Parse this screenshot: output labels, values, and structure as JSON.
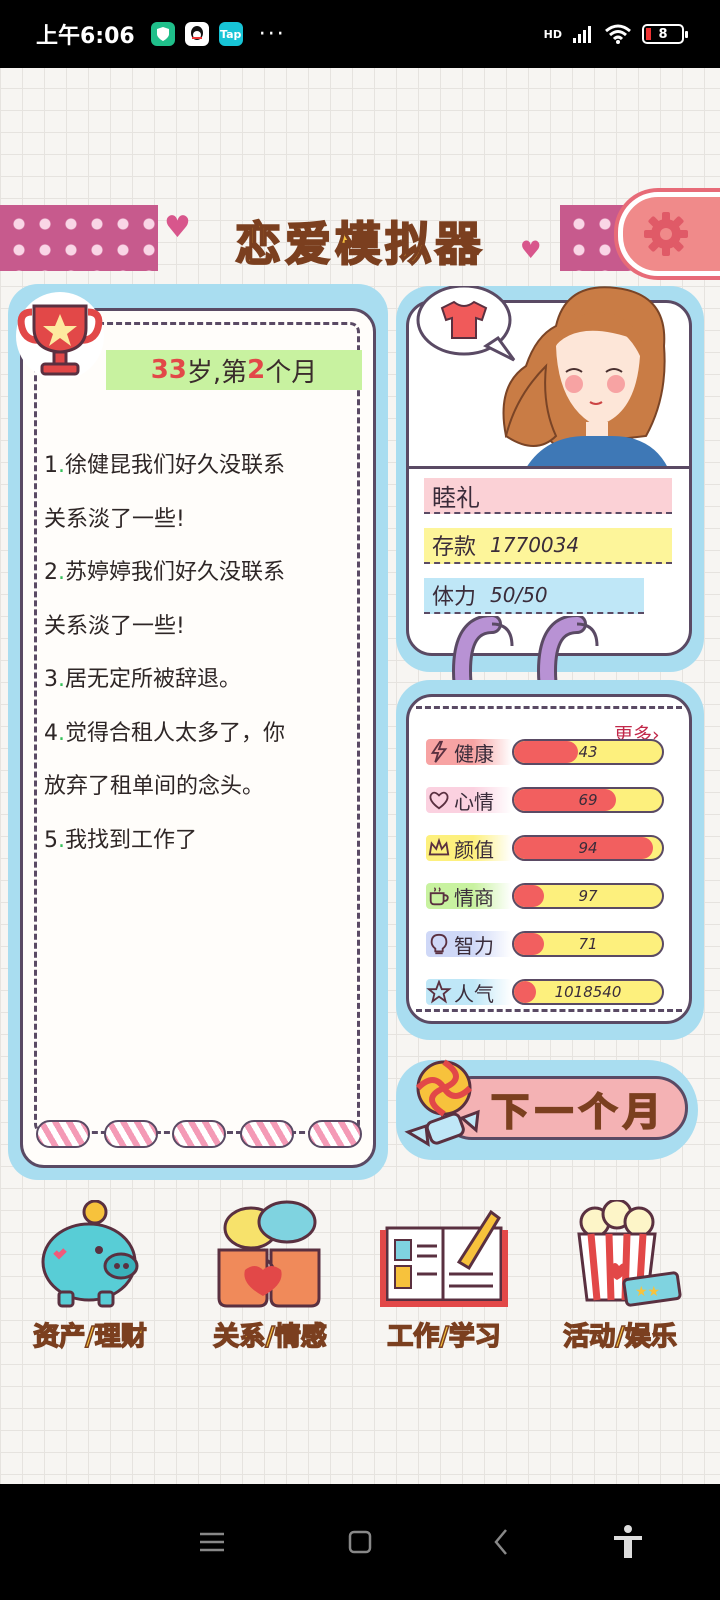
{
  "status_bar": {
    "time": "上午6:06",
    "notifications": [
      "shield-app-icon",
      "qq-icon",
      "taptap-icon"
    ],
    "taptap_label": "Tap",
    "more": "···",
    "network": "HD",
    "battery": "8"
  },
  "header": {
    "title": "恋爱模拟器"
  },
  "journal": {
    "age_prefix_num": "33",
    "age_mid": "岁,第",
    "month_num": "2",
    "age_suffix": "个月",
    "events": [
      {
        "n": "1",
        "text": "徐健昆我们好久没联系"
      },
      {
        "n": "",
        "text": "关系淡了一些!"
      },
      {
        "n": "2",
        "text": "苏婷婷我们好久没联系"
      },
      {
        "n": "",
        "text": "关系淡了一些!"
      },
      {
        "n": "3",
        "text": "居无定所被辞退。"
      },
      {
        "n": "4",
        "text": "觉得合租人太多了，你"
      },
      {
        "n": "",
        "text": "放弃了租单间的念头。"
      },
      {
        "n": "5",
        "text": "我找到工作了"
      }
    ]
  },
  "character": {
    "name": "睦礼",
    "savings_label": "存款",
    "savings_value": "1770034",
    "stamina_label": "体力",
    "stamina_value": "50/50"
  },
  "stats": {
    "more_label": "更多›",
    "items": [
      {
        "label": "健康",
        "value": "43",
        "level": 0.43,
        "icon": "lightning-icon",
        "tint": "#f7a3a3"
      },
      {
        "label": "心情",
        "value": "69",
        "level": 0.69,
        "icon": "heart-outline-icon",
        "tint": "#fbd1e0"
      },
      {
        "label": "颜值",
        "value": "94",
        "level": 0.94,
        "icon": "crown-icon",
        "tint": "#fdf07d"
      },
      {
        "label": "情商",
        "value": "97",
        "level": 0.2,
        "icon": "teacup-icon",
        "tint": "#c8f2a0"
      },
      {
        "label": "智力",
        "value": "71",
        "level": 0.2,
        "icon": "lightbulb-icon",
        "tint": "#cfd8f7"
      },
      {
        "label": "人气",
        "value": "1018540",
        "level": 0.15,
        "icon": "star-outline-icon",
        "tint": "#bfe7f7"
      }
    ]
  },
  "next_button": "下一个月",
  "bottom_nav": [
    {
      "label": "资产/理财",
      "icon": "piggy-bank-icon"
    },
    {
      "label": "关系/情感",
      "icon": "coffee-cups-icon"
    },
    {
      "label": "工作/学习",
      "icon": "open-book-icon"
    },
    {
      "label": "活动/娱乐",
      "icon": "popcorn-icon"
    }
  ],
  "colors": {
    "accent_yellow": "#f7c23c",
    "outline": "#5a4a64",
    "frame_blue": "#a9ddf0",
    "bar_red": "#f25f5f",
    "bar_yellow": "#fdf07d"
  }
}
